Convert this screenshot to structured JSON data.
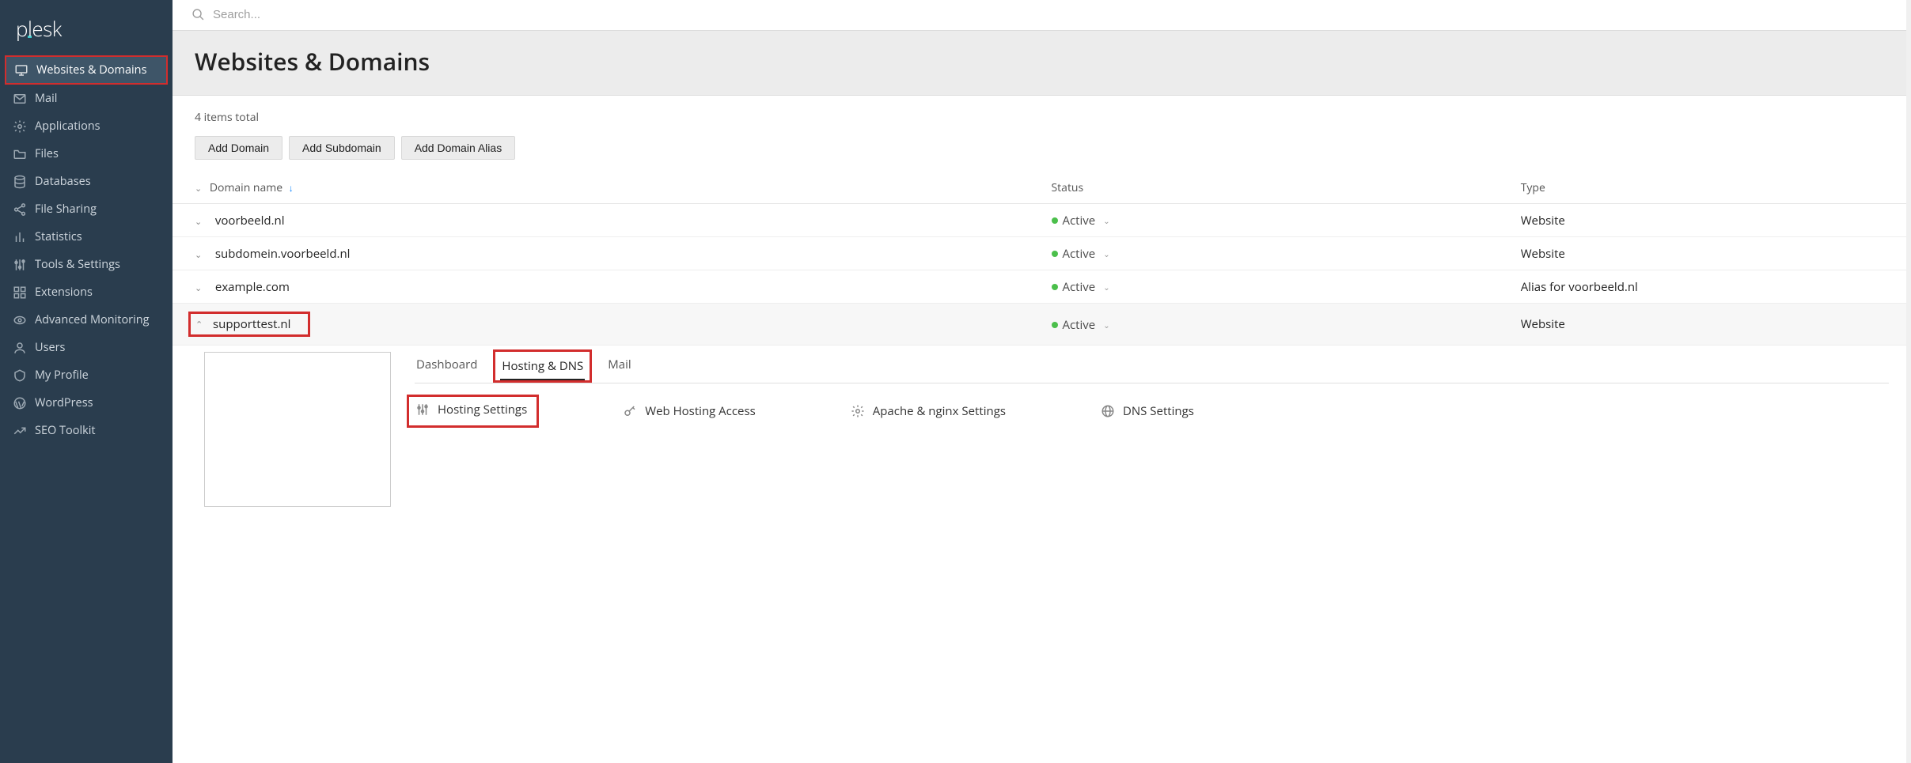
{
  "brand": "plesk",
  "search": {
    "placeholder": "Search..."
  },
  "sidebar": {
    "items": [
      {
        "label": "Websites & Domains"
      },
      {
        "label": "Mail"
      },
      {
        "label": "Applications"
      },
      {
        "label": "Files"
      },
      {
        "label": "Databases"
      },
      {
        "label": "File Sharing"
      },
      {
        "label": "Statistics"
      },
      {
        "label": "Tools & Settings"
      },
      {
        "label": "Extensions"
      },
      {
        "label": "Advanced Monitoring"
      },
      {
        "label": "Users"
      },
      {
        "label": "My Profile"
      },
      {
        "label": "WordPress"
      },
      {
        "label": "SEO Toolkit"
      }
    ]
  },
  "page": {
    "title": "Websites & Domains",
    "items_total": "4 items total"
  },
  "actions": {
    "add_domain": "Add Domain",
    "add_subdomain": "Add Subdomain",
    "add_domain_alias": "Add Domain Alias"
  },
  "table": {
    "columns": {
      "domain": "Domain name",
      "status": "Status",
      "type": "Type"
    },
    "sort_indicator": "↓",
    "rows": [
      {
        "domain": "voorbeeld.nl",
        "status": "Active",
        "type": "Website",
        "expanded": false
      },
      {
        "domain": "subdomein.voorbeeld.nl",
        "status": "Active",
        "type": "Website",
        "expanded": false
      },
      {
        "domain": "example.com",
        "status": "Active",
        "type": "Alias for voorbeeld.nl",
        "expanded": false
      },
      {
        "domain": "supporttest.nl",
        "status": "Active",
        "type": "Website",
        "expanded": true
      }
    ]
  },
  "detail": {
    "tabs": {
      "dashboard": "Dashboard",
      "hosting_dns": "Hosting & DNS",
      "mail": "Mail"
    },
    "tools": {
      "hosting_settings": "Hosting Settings",
      "web_hosting_access": "Web Hosting Access",
      "apache_nginx": "Apache & nginx Settings",
      "dns_settings": "DNS Settings"
    }
  },
  "colors": {
    "highlight": "#d22d2d",
    "active_green": "#4bbf4b",
    "sidebar_bg": "#2a3d4e"
  }
}
